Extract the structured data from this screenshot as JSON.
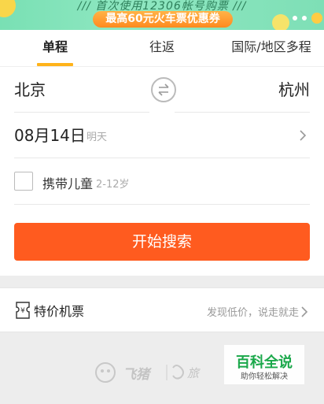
{
  "banner": {
    "line1": "/// 首次使用12306帐号购票 ///",
    "promo": "最高60元火车票优惠券"
  },
  "tabs": [
    {
      "label": "单程",
      "active": true
    },
    {
      "label": "往返",
      "active": false
    },
    {
      "label": "国际/地区多程",
      "active": false
    }
  ],
  "route": {
    "from": "北京",
    "to": "杭州"
  },
  "date": {
    "value": "08月14日",
    "sub": "明天"
  },
  "child": {
    "label": "携带儿童",
    "age_hint": "2-12岁",
    "checked": false
  },
  "search_button": "开始搜索",
  "special": {
    "label": "特价机票",
    "hint": "发现低价，说走就走"
  },
  "footer": {
    "brand1": "飞猪",
    "brand2": "旅"
  },
  "watermark": {
    "title": "百科全说",
    "subtitle": "助你轻松解决"
  },
  "colors": {
    "accent": "#ff5b1f",
    "tab_indicator": "#ffb31a",
    "banner_bg": "#8fe7c1"
  }
}
